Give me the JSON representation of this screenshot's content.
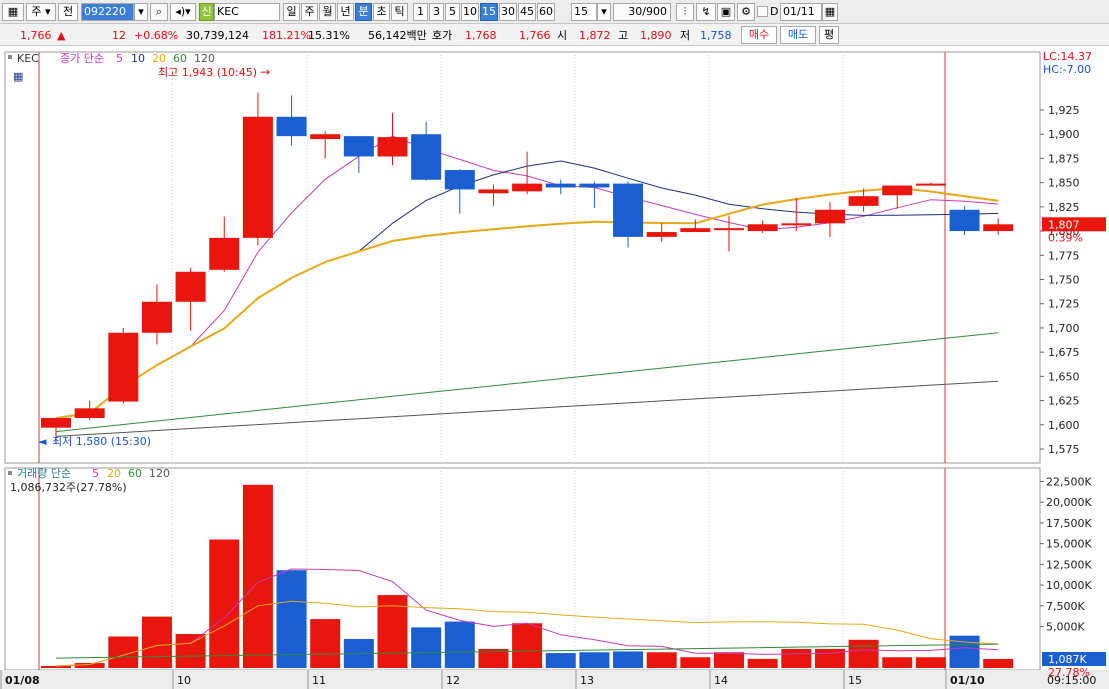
{
  "toolbar": {
    "market": "주",
    "prev_label": "전",
    "code": "092220",
    "stock_name": "KEC",
    "stock_badge": "신",
    "periods": [
      "일",
      "주",
      "월",
      "년",
      "분",
      "초",
      "틱"
    ],
    "minutes": [
      "1",
      "3",
      "5",
      "10",
      "15",
      "30",
      "45",
      "60"
    ],
    "selected_minute": "15",
    "count_value": "15",
    "range": "30/900",
    "d_label": "D",
    "date": "01/11"
  },
  "info": {
    "price": "1,766",
    "arrow": "▲",
    "change": "12",
    "change_pct": "+0.68%",
    "volume": "30,739,124",
    "vol_ratio": "181.21%",
    "turnover": "15.31%",
    "amount": "56,142백만",
    "quote_label": "호가",
    "ask": "1,768",
    "bid": "1,766",
    "open_label": "시",
    "open": "1,872",
    "high_label": "고",
    "high": "1,890",
    "low_label": "저",
    "low": "1,758",
    "buy_button": "매수",
    "sell_button": "매도",
    "eval_button": "평"
  },
  "price_pane": {
    "stock": "KEC",
    "ma_label": "종가 단순",
    "ma_periods": [
      "5",
      "10",
      "20",
      "60",
      "120"
    ],
    "lc": "LC:14.37",
    "hc": "HC:-7.00",
    "high_annot": "최고 1,943 (10:45)",
    "low_annot": "최저 1,580 (15:30)",
    "current_price": "1,807",
    "current_pct": "0.39%",
    "yticks": [
      "1,925",
      "1,900",
      "1,875",
      "1,850",
      "1,825",
      "1,800",
      "1,775",
      "1,750",
      "1,725",
      "1,700",
      "1,675",
      "1,650",
      "1,625",
      "1,600",
      "1,575"
    ]
  },
  "volume_pane": {
    "label": "거래량 단순",
    "ma_periods": [
      "5",
      "20",
      "60",
      "120"
    ],
    "info": "1,086,732주(27.78%)",
    "current": "1,087K",
    "current_pct": "27.78%",
    "yticks": [
      "22,500K",
      "20,000K",
      "17,500K",
      "15,000K",
      "12,500K",
      "10,000K",
      "7,500K",
      "5,000K"
    ]
  },
  "xaxis": {
    "labels": [
      "01/08",
      "10",
      "11",
      "12",
      "13",
      "14",
      "15",
      "01/10"
    ],
    "time": "09:15:00"
  },
  "colors": {
    "up": "#e8160c",
    "down": "#1a5fd1",
    "ma5": "#c73ab8",
    "ma10": "#1f2f7a",
    "ma20": "#e6a817",
    "ma60": "#2f8a3a",
    "ma120": "#555555"
  },
  "chart_data": {
    "type": "candlestick",
    "candles": [
      {
        "o": 1597,
        "h": 1607,
        "l": 1580,
        "c": 1607
      },
      {
        "o": 1607,
        "h": 1625,
        "l": 1605,
        "c": 1617
      },
      {
        "o": 1624,
        "h": 1700,
        "l": 1622,
        "c": 1695
      },
      {
        "o": 1695,
        "h": 1745,
        "l": 1683,
        "c": 1727
      },
      {
        "o": 1727,
        "h": 1762,
        "l": 1697,
        "c": 1758
      },
      {
        "o": 1760,
        "h": 1815,
        "l": 1758,
        "c": 1793
      },
      {
        "o": 1793,
        "h": 1943,
        "l": 1785,
        "c": 1918
      },
      {
        "o": 1918,
        "h": 1940,
        "l": 1888,
        "c": 1898
      },
      {
        "o": 1895,
        "h": 1903,
        "l": 1875,
        "c": 1900
      },
      {
        "o": 1898,
        "h": 1882,
        "l": 1860,
        "c": 1877
      },
      {
        "o": 1877,
        "h": 1922,
        "l": 1868,
        "c": 1897
      },
      {
        "o": 1900,
        "h": 1913,
        "l": 1852,
        "c": 1853
      },
      {
        "o": 1863,
        "h": 1864,
        "l": 1818,
        "c": 1843
      },
      {
        "o": 1839,
        "h": 1848,
        "l": 1826,
        "c": 1843
      },
      {
        "o": 1841,
        "h": 1882,
        "l": 1838,
        "c": 1849
      },
      {
        "o": 1849,
        "h": 1853,
        "l": 1838,
        "c": 1845
      },
      {
        "o": 1849,
        "h": 1851,
        "l": 1824,
        "c": 1845
      },
      {
        "o": 1849,
        "h": 1851,
        "l": 1783,
        "c": 1794
      },
      {
        "o": 1794,
        "h": 1808,
        "l": 1789,
        "c": 1799
      },
      {
        "o": 1799,
        "h": 1812,
        "l": 1799,
        "c": 1803
      },
      {
        "o": 1803,
        "h": 1816,
        "l": 1779,
        "c": 1803
      },
      {
        "o": 1800,
        "h": 1811,
        "l": 1798,
        "c": 1807
      },
      {
        "o": 1806,
        "h": 1834,
        "l": 1800,
        "c": 1808
      },
      {
        "o": 1808,
        "h": 1830,
        "l": 1794,
        "c": 1822
      },
      {
        "o": 1826,
        "h": 1844,
        "l": 1820,
        "c": 1836
      },
      {
        "o": 1837,
        "h": 1847,
        "l": 1823,
        "c": 1847
      },
      {
        "o": 1849,
        "h": 1850,
        "l": 1848,
        "c": 1849
      },
      {
        "o": 1822,
        "h": 1826,
        "l": 1796,
        "c": 1800
      },
      {
        "o": 1800,
        "h": 1813,
        "l": 1796,
        "c": 1807
      }
    ],
    "volumes": [
      240,
      600,
      3800,
      6200,
      4100,
      15500,
      22100,
      11800,
      5900,
      3500,
      8800,
      4900,
      5600,
      2300,
      5400,
      1800,
      1900,
      2000,
      1900,
      1300,
      1900,
      1100,
      2300,
      2300,
      3400,
      1300,
      1300,
      3900,
      1087
    ]
  }
}
